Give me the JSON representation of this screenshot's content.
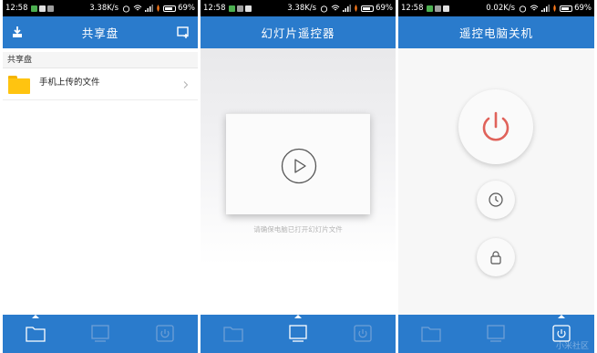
{
  "status_bars": [
    {
      "time": "12:58",
      "speed": "3.38K/s",
      "battery": "69%"
    },
    {
      "time": "12:58",
      "speed": "3.38K/s",
      "battery": "69%"
    },
    {
      "time": "12:58",
      "speed": "0.02K/s",
      "battery": "69%"
    }
  ],
  "screen1": {
    "title": "共享盘",
    "breadcrumb": "共享盘",
    "folders": [
      {
        "name": "手机上传的文件"
      }
    ]
  },
  "screen2": {
    "title": "幻灯片遥控器",
    "hint": "请确保电脑已打开幻灯片文件"
  },
  "screen3": {
    "title": "遥控电脑关机",
    "watermark": "小米社区"
  },
  "colors": {
    "accent": "#2a7bcc",
    "power_red": "#e0625a",
    "folder_yellow": "#ffc410"
  },
  "icons": {
    "tab_folder": "folder-icon",
    "tab_slideshow": "slideshow-icon",
    "tab_power": "power-icon"
  }
}
